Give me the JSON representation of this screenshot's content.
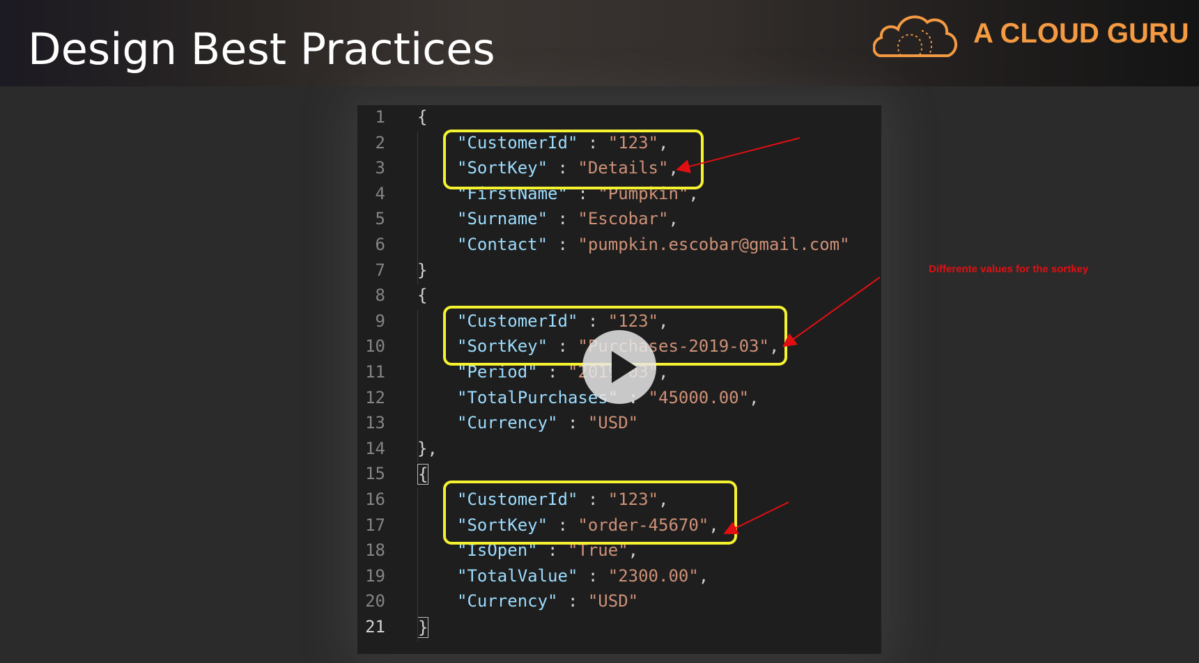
{
  "slide": {
    "title": "Design Best Practices",
    "brand": "A CLOUD GURU"
  },
  "annotation": "Differente values for the sortkey",
  "colors": {
    "brand_orange": "#f49a42",
    "highlight_yellow": "#f5f230",
    "annotation_red": "#e20f12",
    "editor_bg": "#1e1e1e",
    "json_key": "#9cdcfe",
    "json_string": "#ce9178"
  },
  "play_button_icon": "play-icon",
  "editor": {
    "lines": [
      {
        "n": "1",
        "open": "{"
      },
      {
        "n": "2",
        "key": "\"CustomerId\"",
        "sep": " : ",
        "val": "\"123\"",
        "end": ","
      },
      {
        "n": "3",
        "key": "\"SortKey\"",
        "sep": " : ",
        "val": "\"Details\"",
        "end": ","
      },
      {
        "n": "4",
        "key": "\"FirstName\"",
        "sep": " : ",
        "val": "\"Pumpkin\"",
        "end": ","
      },
      {
        "n": "5",
        "key": "\"Surname\"",
        "sep": " : ",
        "val": "\"Escobar\"",
        "end": ","
      },
      {
        "n": "6",
        "key": "\"Contact\"",
        "sep": " : ",
        "val": "\"pumpkin.escobar@gmail.com\"",
        "end": ""
      },
      {
        "n": "7",
        "open": "}"
      },
      {
        "n": "8",
        "open": "{"
      },
      {
        "n": "9",
        "key": "\"CustomerId\"",
        "sep": " : ",
        "val": "\"123\"",
        "end": ","
      },
      {
        "n": "10",
        "key": "\"SortKey\"",
        "sep": " : ",
        "val": "\"Purchases-2019-03\"",
        "end": ","
      },
      {
        "n": "11",
        "key": "\"Period\"",
        "sep": " : ",
        "val": "\"2019-03\"",
        "end": ","
      },
      {
        "n": "12",
        "key": "\"TotalPurchases\"",
        "sep": " : ",
        "val": "\"45000.00\"",
        "end": ","
      },
      {
        "n": "13",
        "key": "\"Currency\"",
        "sep": " : ",
        "val": "\"USD\"",
        "end": ""
      },
      {
        "n": "14",
        "open": "},"
      },
      {
        "n": "15",
        "open": "{"
      },
      {
        "n": "16",
        "key": "\"CustomerId\"",
        "sep": " : ",
        "val": "\"123\"",
        "end": ","
      },
      {
        "n": "17",
        "key": "\"SortKey\"",
        "sep": " : ",
        "val": "\"order-45670\"",
        "end": ","
      },
      {
        "n": "18",
        "key": "\"IsOpen\"",
        "sep": " : ",
        "val": "\"True\"",
        "end": ","
      },
      {
        "n": "19",
        "key": "\"TotalValue\"",
        "sep": " : ",
        "val": "\"2300.00\"",
        "end": ","
      },
      {
        "n": "20",
        "key": "\"Currency\"",
        "sep": " : ",
        "val": "\"USD\"",
        "end": ""
      },
      {
        "n": "21",
        "open": "}"
      }
    ]
  }
}
